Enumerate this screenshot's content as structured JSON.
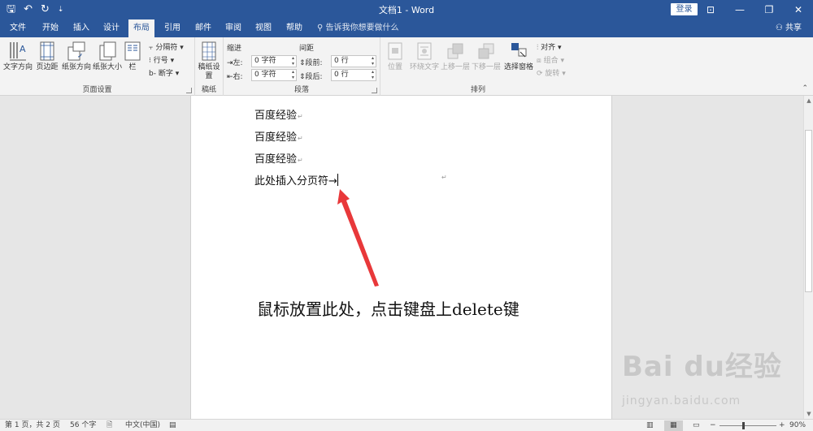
{
  "title_bar": {
    "doc_title": "文档1 - Word",
    "login": "登录",
    "qat": {
      "save": "🖫",
      "undo": "↶",
      "redo": "↻",
      "customize": "⇣"
    },
    "controls": {
      "ribbon_opts": "⊡",
      "minimize": "—",
      "restore": "❐",
      "close": "✕"
    }
  },
  "tabs": [
    "文件",
    "开始",
    "插入",
    "设计",
    "布局",
    "引用",
    "邮件",
    "审阅",
    "视图",
    "帮助"
  ],
  "active_tab": "布局",
  "tell_me": "告诉我你想要做什么",
  "share": "共享",
  "ribbon": {
    "page_setup": {
      "label": "页面设置",
      "text_direction": "文字方向",
      "margins": "页边距",
      "orientation": "纸张方向",
      "size": "纸张大小",
      "columns": "栏",
      "breaks": "分隔符",
      "line_numbers": "行号",
      "hyphenation": "断字"
    },
    "manuscript": {
      "label": "稿纸",
      "button": "稿纸设置"
    },
    "paragraph": {
      "label": "段落",
      "indent": "缩进",
      "spacing": "间距",
      "left_label": "左:",
      "right_label": "右:",
      "before_label": "段前:",
      "after_label": "段后:",
      "left_value": "0 字符",
      "right_value": "0 字符",
      "before_value": "0 行",
      "after_value": "0 行"
    },
    "arrange": {
      "label": "排列",
      "position": "位置",
      "wrap_text": "环绕文字",
      "bring_forward": "上移一层",
      "send_backward": "下移一层",
      "selection_pane": "选择窗格",
      "align": "对齐",
      "group": "组合",
      "rotate": "旋转"
    }
  },
  "document": {
    "lines": [
      "百度经验",
      "百度经验",
      "百度经验"
    ],
    "page_break_line": "此处插入分页符",
    "para_mark": "↵",
    "annotation": "鼠标放置此处，点击键盘上delete键"
  },
  "watermark": {
    "main": "Bai du经验",
    "sub": "jingyan.baidu.com"
  },
  "status_bar": {
    "page": "第 1 页，共 2 页",
    "words": "56 个字",
    "language": "中文(中国)",
    "zoom": "90%"
  },
  "colors": {
    "accent": "#2b579a",
    "arrow": "#e8383a"
  }
}
